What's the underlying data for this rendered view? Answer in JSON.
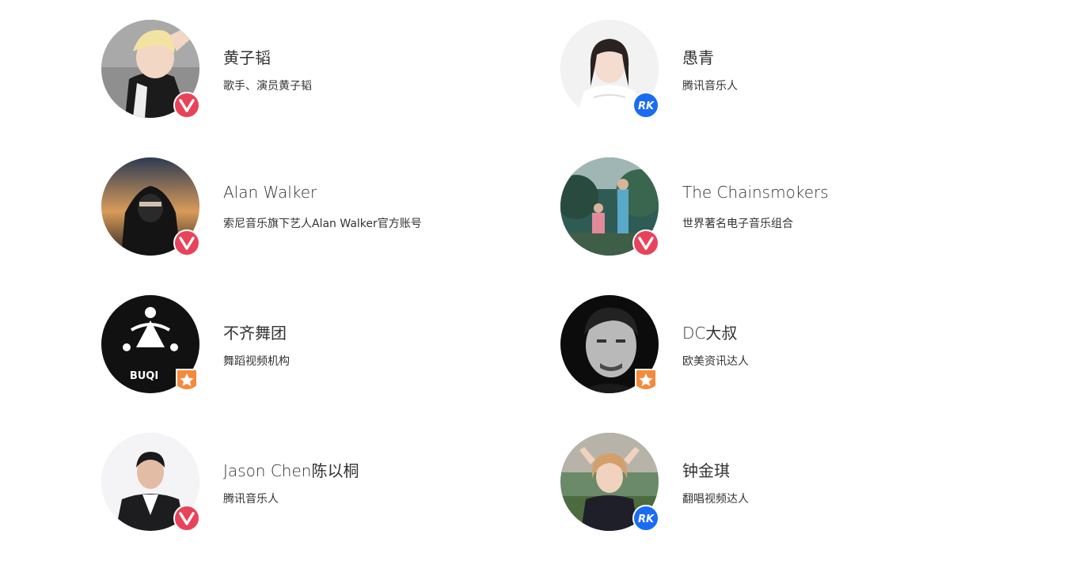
{
  "artists": [
    {
      "name": "黄子韬",
      "desc": "歌手、演员黄子韬",
      "badge": "v-badge-icon"
    },
    {
      "name": "愚青",
      "desc": "腾讯音乐人",
      "badge": "tme-badge-icon"
    },
    {
      "name": "Alan Walker",
      "desc": "索尼音乐旗下艺人Alan Walker官方账号",
      "badge": "v-badge-icon"
    },
    {
      "name": "The Chainsmokers",
      "desc": "世界著名电子音乐组合",
      "badge": "v-badge-icon"
    },
    {
      "name": "不齐舞团",
      "desc": "舞蹈视频机构",
      "badge": "star-badge-icon",
      "logo_text": "BUQI"
    },
    {
      "name": "DC大叔",
      "desc": "欧美资讯达人",
      "badge": "star-badge-icon"
    },
    {
      "name": "Jason Chen陈以桐",
      "desc": "腾讯音乐人",
      "badge": "v-badge-icon"
    },
    {
      "name": "钟金琪",
      "desc": "翻唱视频达人",
      "badge": "tme-badge-icon"
    }
  ],
  "colors": {
    "v_badge": "#e8435a",
    "tme_badge": "#1a6cf3",
    "star_badge": "#f58a3c",
    "text": "#333333"
  }
}
